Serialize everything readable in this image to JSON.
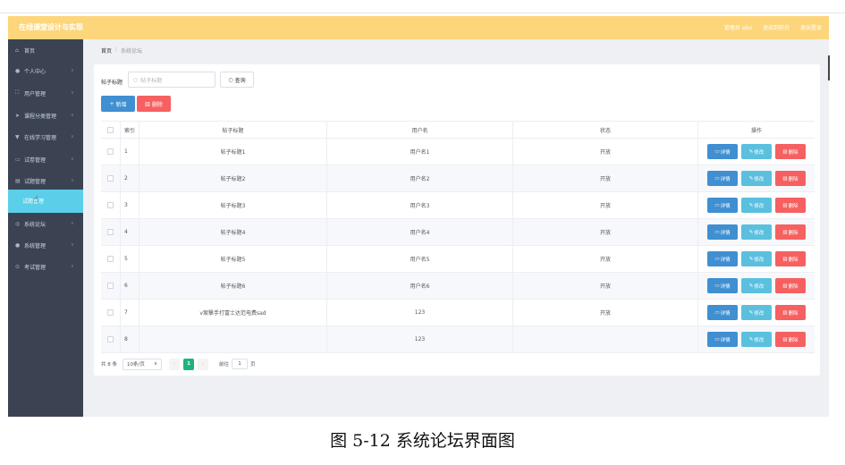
{
  "app": {
    "title": "在线课堂设计与实现"
  },
  "topbar": {
    "role_user": "管理员 abo",
    "back_home": "退出到前台",
    "logout": "退出登录"
  },
  "sidebar": {
    "items": [
      {
        "label": "首页",
        "icon": "home-icon"
      },
      {
        "label": "个人中心",
        "icon": "user-icon"
      },
      {
        "label": "用户管理",
        "icon": "users-icon"
      },
      {
        "label": "课程分类管理",
        "icon": "send-icon"
      },
      {
        "label": "在线学习管理",
        "icon": "filter-icon"
      },
      {
        "label": "试卷管理",
        "icon": "paper-icon"
      },
      {
        "label": "试题管理",
        "icon": "question-icon"
      }
    ],
    "sub_item": {
      "label": "试题管理"
    },
    "items_after": [
      {
        "label": "系统论坛",
        "icon": "forum-icon"
      },
      {
        "label": "系统管理",
        "icon": "settings-icon"
      },
      {
        "label": "考试管理",
        "icon": "exam-icon"
      }
    ]
  },
  "breadcrumb": {
    "home": "首页",
    "separator": "/",
    "current": "系统论坛"
  },
  "search": {
    "label": "帖子标题",
    "placeholder": "帖子标题",
    "button": "查询"
  },
  "actions": {
    "add": "新增",
    "delete": "删除"
  },
  "table": {
    "headers": {
      "index": "索引",
      "title": "帖子标题",
      "user": "用户名",
      "status": "状态",
      "ops": "操作"
    },
    "op_labels": {
      "detail": "详情",
      "edit": "修改",
      "remove": "删除"
    },
    "rows": [
      {
        "index": "1",
        "title": "帖子标题1",
        "user": "用户名1",
        "status": "开放"
      },
      {
        "index": "2",
        "title": "帖子标题2",
        "user": "用户名2",
        "status": "开放"
      },
      {
        "index": "3",
        "title": "帖子标题3",
        "user": "用户名3",
        "status": "开放"
      },
      {
        "index": "4",
        "title": "帖子标题4",
        "user": "用户名4",
        "status": "开放"
      },
      {
        "index": "5",
        "title": "帖子标题5",
        "user": "用户名5",
        "status": "开放"
      },
      {
        "index": "6",
        "title": "帖子标题6",
        "user": "用户名6",
        "status": "开放"
      },
      {
        "index": "7",
        "title": "v案撃手打富士达范电费sad",
        "user": "123",
        "status": "开放"
      },
      {
        "index": "8",
        "title": "",
        "user": "123",
        "status": ""
      }
    ]
  },
  "pagination": {
    "total": "共 8 条",
    "page_size": "10条/页",
    "current_page": "1",
    "goto_prefix": "前往",
    "goto_value": "1",
    "goto_suffix": "页"
  },
  "caption": "图 5-12 系统论坛界面图",
  "colors": {
    "topbar": "#fdd67c",
    "sidebar": "#3b4353",
    "active_sub": "#5bcfe9",
    "primary": "#3f8fd1",
    "info": "#5bc0de",
    "danger": "#f66060",
    "page_active": "#21b37d"
  }
}
